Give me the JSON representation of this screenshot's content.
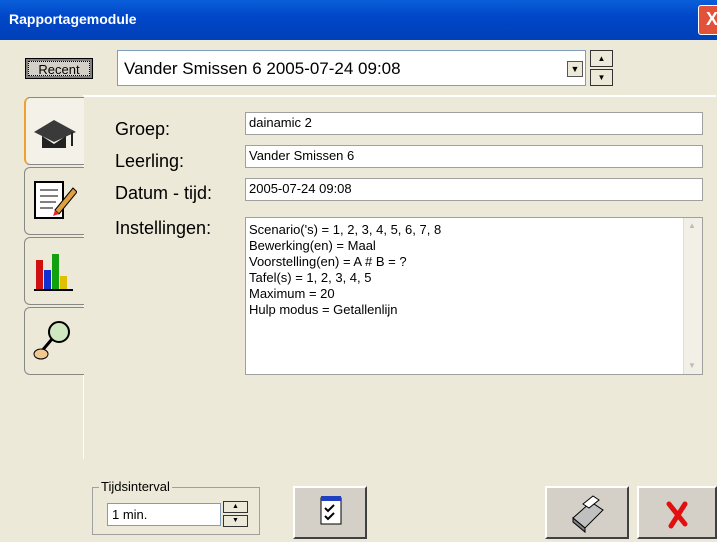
{
  "window": {
    "title": "Rapportagemodule",
    "close_glyph": "X"
  },
  "toolbar": {
    "recent_label": "Recent",
    "selected_report": "Vander Smissen 6 2005-07-24 09:08"
  },
  "tabs": [
    {
      "icon": "graduation-cap-icon",
      "active": true
    },
    {
      "icon": "notepad-pencil-icon",
      "active": false
    },
    {
      "icon": "bar-chart-icon",
      "active": false
    },
    {
      "icon": "magnifier-hand-icon",
      "active": false
    }
  ],
  "form": {
    "groep_label": "Groep:",
    "groep_value": "dainamic 2",
    "leerling_label": "Leerling:",
    "leerling_value": "Vander Smissen 6",
    "datum_label": "Datum - tijd:",
    "datum_value": "2005-07-24 09:08",
    "instellingen_label": "Instellingen:",
    "instellingen_value": "Scenario('s) = 1, 2, 3, 4, 5, 6, 7, 8\nBewerking(en) = Maal\nVoorstelling(en) = A # B = ?\nTafel(s) = 1, 2, 3, 4, 5\nMaximum = 20\nHulp modus = Getallenlijn"
  },
  "footer": {
    "interval_legend": "Tijdsinterval",
    "interval_value": "1 min."
  },
  "colors": {
    "title_bar": "#0047c9",
    "background": "#ece9d8",
    "close_red": "#e2513a"
  }
}
